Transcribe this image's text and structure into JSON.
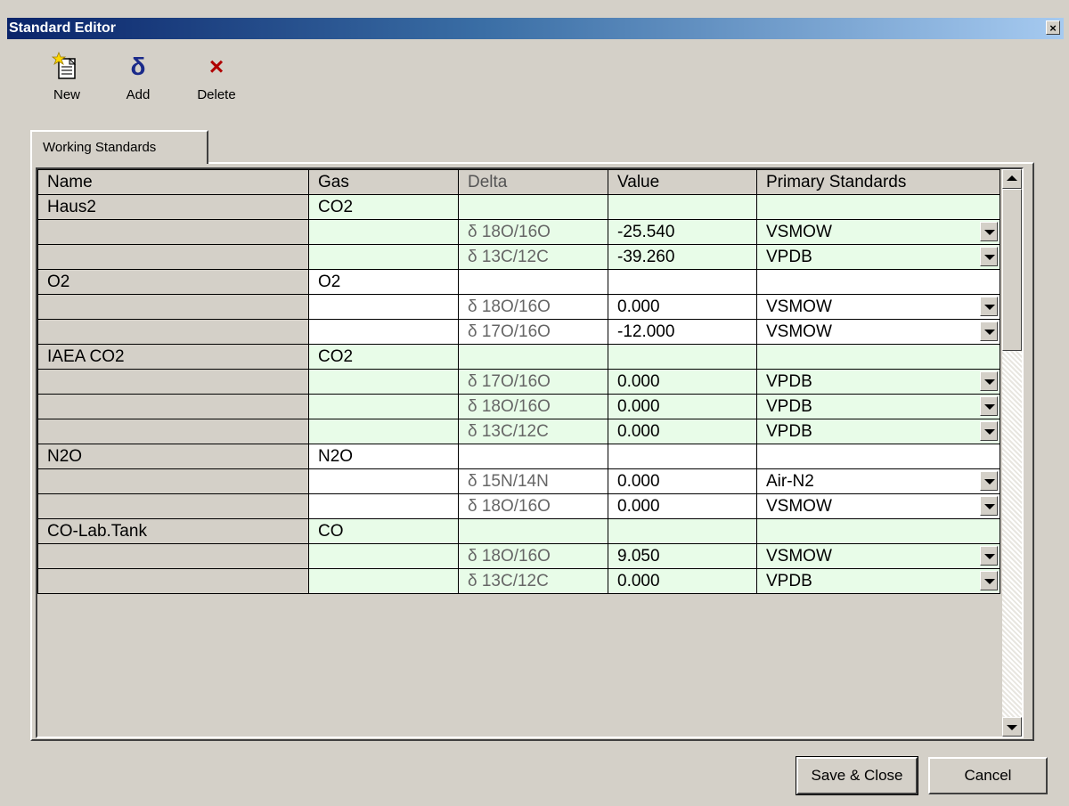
{
  "window": {
    "title": "Standard Editor",
    "close_symbol": "×"
  },
  "toolbar": {
    "new_label": "New",
    "add_label": "Add",
    "delete_label": "Delete",
    "add_symbol": "δ",
    "delete_symbol": "×"
  },
  "tab": {
    "label": "Working Standards"
  },
  "table": {
    "headers": [
      "Name",
      "Gas",
      "Delta",
      "Value",
      "Primary Standards"
    ],
    "rows": [
      {
        "name": "Haus2",
        "gas": "CO2",
        "delta": "",
        "value": "",
        "primary": "",
        "tint": "green",
        "dropdown": false
      },
      {
        "name": "",
        "gas": "",
        "delta": "δ 18O/16O",
        "value": "-25.540",
        "primary": "VSMOW",
        "tint": "green",
        "dropdown": true
      },
      {
        "name": "",
        "gas": "",
        "delta": "δ 13C/12C",
        "value": "-39.260",
        "primary": "VPDB",
        "tint": "green",
        "dropdown": true
      },
      {
        "name": "O2",
        "gas": "O2",
        "delta": "",
        "value": "",
        "primary": "",
        "tint": "white",
        "dropdown": false
      },
      {
        "name": "",
        "gas": "",
        "delta": "δ 18O/16O",
        "value": "0.000",
        "primary": "VSMOW",
        "tint": "white",
        "dropdown": true
      },
      {
        "name": "",
        "gas": "",
        "delta": "δ 17O/16O",
        "value": "-12.000",
        "primary": "VSMOW",
        "tint": "white",
        "dropdown": true
      },
      {
        "name": "IAEA CO2",
        "gas": "CO2",
        "delta": "",
        "value": "",
        "primary": "",
        "tint": "green",
        "dropdown": false
      },
      {
        "name": "",
        "gas": "",
        "delta": "δ 17O/16O",
        "value": "0.000",
        "primary": "VPDB",
        "tint": "green",
        "dropdown": true
      },
      {
        "name": "",
        "gas": "",
        "delta": "δ 18O/16O",
        "value": "0.000",
        "primary": "VPDB",
        "tint": "green",
        "dropdown": true
      },
      {
        "name": "",
        "gas": "",
        "delta": "δ 13C/12C",
        "value": "0.000",
        "primary": "VPDB",
        "tint": "green",
        "dropdown": true
      },
      {
        "name": "N2O",
        "gas": "N2O",
        "delta": "",
        "value": "",
        "primary": "",
        "tint": "white",
        "dropdown": false
      },
      {
        "name": "",
        "gas": "",
        "delta": "δ 15N/14N",
        "value": "0.000",
        "primary": "Air-N2",
        "tint": "white",
        "dropdown": true
      },
      {
        "name": "",
        "gas": "",
        "delta": "δ 18O/16O",
        "value": "0.000",
        "primary": "VSMOW",
        "tint": "white",
        "dropdown": true
      },
      {
        "name": "CO-Lab.Tank",
        "gas": "CO",
        "delta": "",
        "value": "",
        "primary": "",
        "tint": "green",
        "dropdown": false
      },
      {
        "name": "",
        "gas": "",
        "delta": "δ 18O/16O",
        "value": "9.050",
        "primary": "VSMOW",
        "tint": "green",
        "dropdown": true
      },
      {
        "name": "",
        "gas": "",
        "delta": "δ 13C/12C",
        "value": "0.000",
        "primary": "VPDB",
        "tint": "green",
        "dropdown": true
      }
    ]
  },
  "buttons": {
    "save_close": "Save & Close",
    "cancel": "Cancel"
  },
  "colors": {
    "green_row": "#e8fce8",
    "white_row": "#ffffff",
    "titlebar": "#0a246a",
    "dialog_bg": "#d4d0c8"
  },
  "icons": {
    "new": "new-document-icon",
    "add": "delta-icon",
    "delete": "red-x-icon"
  }
}
